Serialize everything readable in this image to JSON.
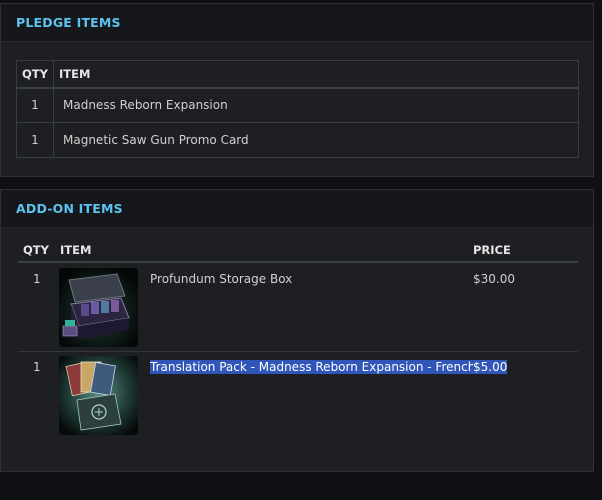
{
  "pledge": {
    "title": "PLEDGE ITEMS",
    "headers": {
      "qty": "QTY",
      "item": "ITEM"
    },
    "rows": [
      {
        "qty": "1",
        "item": "Madness Reborn Expansion"
      },
      {
        "qty": "1",
        "item": "Magnetic Saw Gun Promo Card"
      }
    ]
  },
  "addon": {
    "title": "ADD-ON ITEMS",
    "headers": {
      "qty": "QTY",
      "item": "ITEM",
      "price": "PRICE"
    },
    "rows": [
      {
        "qty": "1",
        "item": "Profundum Storage Box",
        "price": "$30.00",
        "image": "storage-box-image"
      },
      {
        "qty": "1",
        "item": "Translation Pack - Madness Reborn Expansion - French",
        "price": "$5.00",
        "image": "translation-pack-image",
        "selected": true
      }
    ]
  },
  "colors": {
    "accent": "#5cc3ef",
    "selection": "#2f56b8",
    "panel": "#1d1f22",
    "panel_header": "#15171a"
  }
}
